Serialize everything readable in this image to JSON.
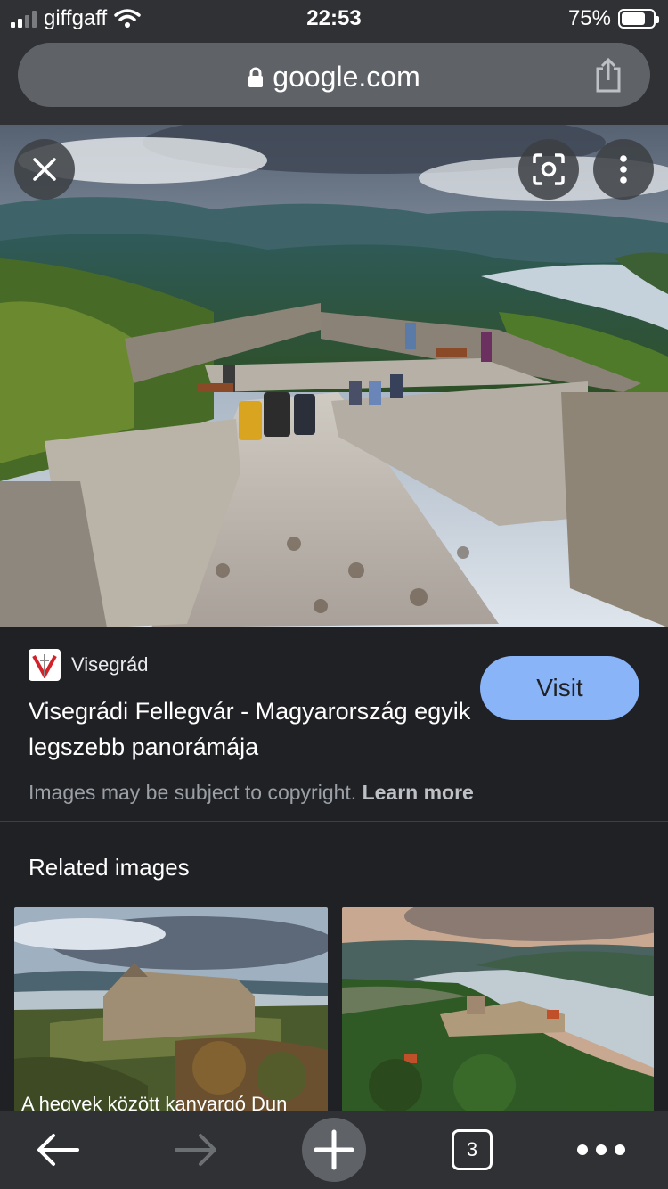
{
  "status_bar": {
    "carrier": "giffgaff",
    "time": "22:53",
    "battery_percent": "75%",
    "battery_level": 0.75
  },
  "url_bar": {
    "domain": "google.com",
    "icons": [
      "lock-icon",
      "share-icon"
    ]
  },
  "image_viewer": {
    "buttons": [
      "close-icon",
      "lens-icon",
      "more-vert-icon"
    ]
  },
  "result": {
    "site_name": "Visegrád",
    "title": "Visegrádi Fellegvár - Magyarország egyik legszebb panorámája",
    "visit_label": "Visit",
    "copyright_text": "Images may be subject to copyright.",
    "learn_more": "Learn more"
  },
  "related": {
    "heading": "Related images",
    "items": [
      {
        "caption": "A hegyek között kanyargó Dun"
      },
      {
        "caption": ""
      }
    ]
  },
  "toolbar": {
    "tab_count": "3",
    "icons": [
      "back-arrow-icon",
      "forward-arrow-icon",
      "new-tab-plus-icon",
      "tabs-icon",
      "more-horiz-icon"
    ]
  },
  "colors": {
    "background": "#202124",
    "bar": "#303134",
    "accent": "#8ab4f8"
  }
}
